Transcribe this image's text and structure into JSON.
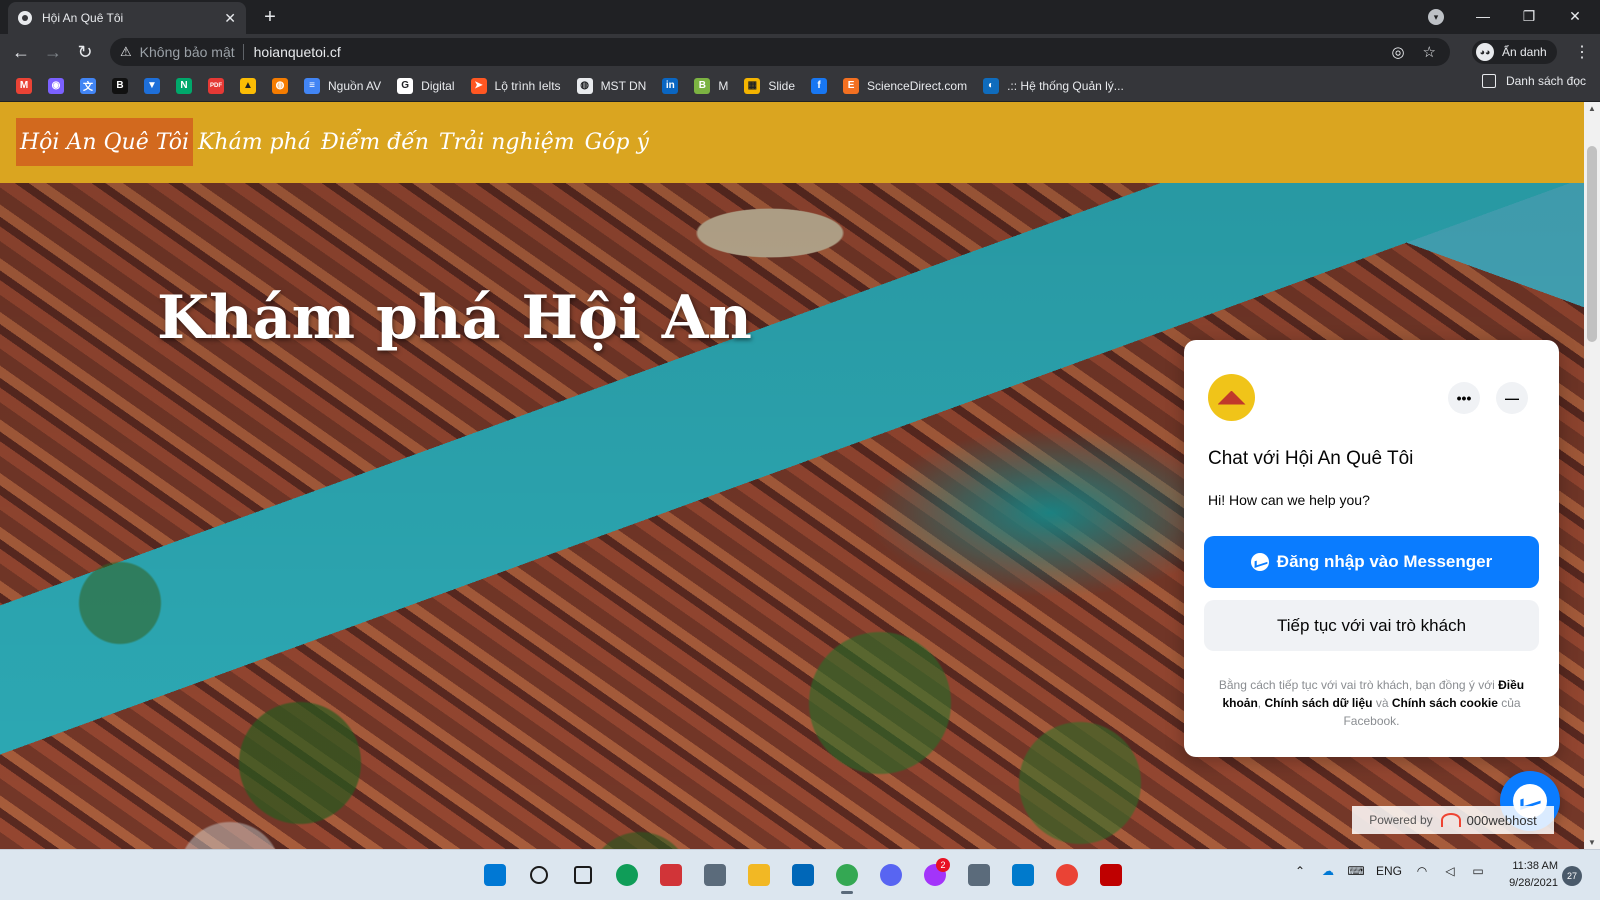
{
  "browser": {
    "tab": {
      "title": "Hội An Quê Tôi"
    },
    "address": {
      "security_label": "Không bảo mật",
      "url": "hoianquetoi.cf"
    },
    "profile_label": "Ẩn danh",
    "bookmarks": [
      {
        "icon": "gmail-icon",
        "label": "",
        "color": "#ea4335",
        "glyph": "M"
      },
      {
        "icon": "circle-app-icon",
        "label": "",
        "color": "#7b61ff",
        "glyph": "◉"
      },
      {
        "icon": "translate-icon",
        "label": "",
        "color": "#4285f4",
        "glyph": "文"
      },
      {
        "icon": "bold-b-icon",
        "label": "",
        "color": "#111111",
        "glyph": "B"
      },
      {
        "icon": "shield-app-icon",
        "label": "",
        "color": "#1e6fd9",
        "glyph": "▼"
      },
      {
        "icon": "n-app-icon",
        "label": "",
        "color": "#00a86b",
        "glyph": "N"
      },
      {
        "icon": "pdf-icon",
        "label": "",
        "color": "#e53935",
        "glyph": "PDF"
      },
      {
        "icon": "drive-icon",
        "label": "",
        "color": "#fbbc04",
        "glyph": "▲"
      },
      {
        "icon": "orange-app-icon",
        "label": "",
        "color": "#f57c00",
        "glyph": "◍"
      },
      {
        "icon": "docs-icon",
        "label": "Nguồn AV",
        "color": "#4285f4",
        "glyph": "≡"
      },
      {
        "icon": "google-icon",
        "label": "Digital",
        "color": "#ffffff",
        "glyph": "G"
      },
      {
        "icon": "arrow-app-icon",
        "label": "Lộ trình Ielts",
        "color": "#ff5722",
        "glyph": "➤"
      },
      {
        "icon": "globe-icon",
        "label": "MST DN",
        "color": "#e8eaed",
        "glyph": "◍"
      },
      {
        "icon": "linkedin-icon",
        "label": "",
        "color": "#0a66c2",
        "glyph": "in"
      },
      {
        "icon": "b-green-icon",
        "label": "M",
        "color": "#7cb342",
        "glyph": "B"
      },
      {
        "icon": "slides-icon",
        "label": "Slide",
        "color": "#f4b400",
        "glyph": "▦"
      },
      {
        "icon": "facebook-icon",
        "label": "",
        "color": "#1877f2",
        "glyph": "f"
      },
      {
        "icon": "sciencedirect-icon",
        "label": "ScienceDirect.com",
        "color": "#f37021",
        "glyph": "E"
      },
      {
        "icon": "edge-small-icon",
        "label": ".:: Hệ thống Quản lý...",
        "color": "#0f6cbd",
        "glyph": "◐"
      }
    ],
    "reading_list_label": "Danh sách đọc"
  },
  "site": {
    "nav": {
      "brand": "Hội An Quê Tôi",
      "items": [
        "Khám phá",
        "Điểm đến",
        "Trải nghiệm",
        "Góp ý"
      ]
    },
    "hero_title": "Khám phá Hội An",
    "colors": {
      "header_bg": "#daa520",
      "brand_bg": "#d2691e"
    }
  },
  "chat": {
    "title": "Chat với Hội An Quê Tôi",
    "greeting": "Hi! How can we help you?",
    "login_button": "Đăng nhập vào Messenger",
    "guest_button": "Tiếp tục với vai trò khách",
    "legal": {
      "prefix": "Bằng cách tiếp tục với vai trò khách, bạn đồng ý với ",
      "terms": "Điều khoản",
      "comma": ", ",
      "data_policy": "Chính sách dữ liệu",
      "and": " và ",
      "cookie_policy": "Chính sách cookie",
      "suffix": " của Facebook."
    },
    "accent_color": "#0a7cff"
  },
  "footer_badge": {
    "prefix": "Powered by",
    "brand": "000webhost"
  },
  "taskbar": {
    "apps": [
      {
        "icon": "windows-start-icon",
        "color": "#0078d4",
        "active": false
      },
      {
        "icon": "search-icon",
        "color": "#1b1b1b",
        "active": false
      },
      {
        "icon": "task-view-icon",
        "color": "#1b1b1b",
        "active": false
      },
      {
        "icon": "edge-icon",
        "color": "#0f9d58",
        "active": false
      },
      {
        "icon": "snipping-tool-icon",
        "color": "#d13438",
        "active": false
      },
      {
        "icon": "calculator-icon",
        "color": "#5b6b7b",
        "active": false
      },
      {
        "icon": "file-explorer-icon",
        "color": "#f2b824",
        "active": false
      },
      {
        "icon": "store-icon",
        "color": "#0067b8",
        "active": false
      },
      {
        "icon": "chrome-icon",
        "color": "#34a853",
        "active": true
      },
      {
        "icon": "discord-icon",
        "color": "#5865f2",
        "active": false
      },
      {
        "icon": "messenger-icon",
        "color": "#a334fa",
        "active": false,
        "badge": "2"
      },
      {
        "icon": "remote-desktop-icon",
        "color": "#5b6b7b",
        "active": false
      },
      {
        "icon": "vscode-icon",
        "color": "#007acc",
        "active": false
      },
      {
        "icon": "chrome-profile-icon",
        "color": "#ea4335",
        "active": false
      },
      {
        "icon": "filezilla-icon",
        "color": "#bf0000",
        "active": false
      }
    ],
    "tray": {
      "language": "ENG"
    },
    "clock": {
      "time": "11:38 AM",
      "date": "9/28/2021"
    },
    "notification_count": "27"
  }
}
